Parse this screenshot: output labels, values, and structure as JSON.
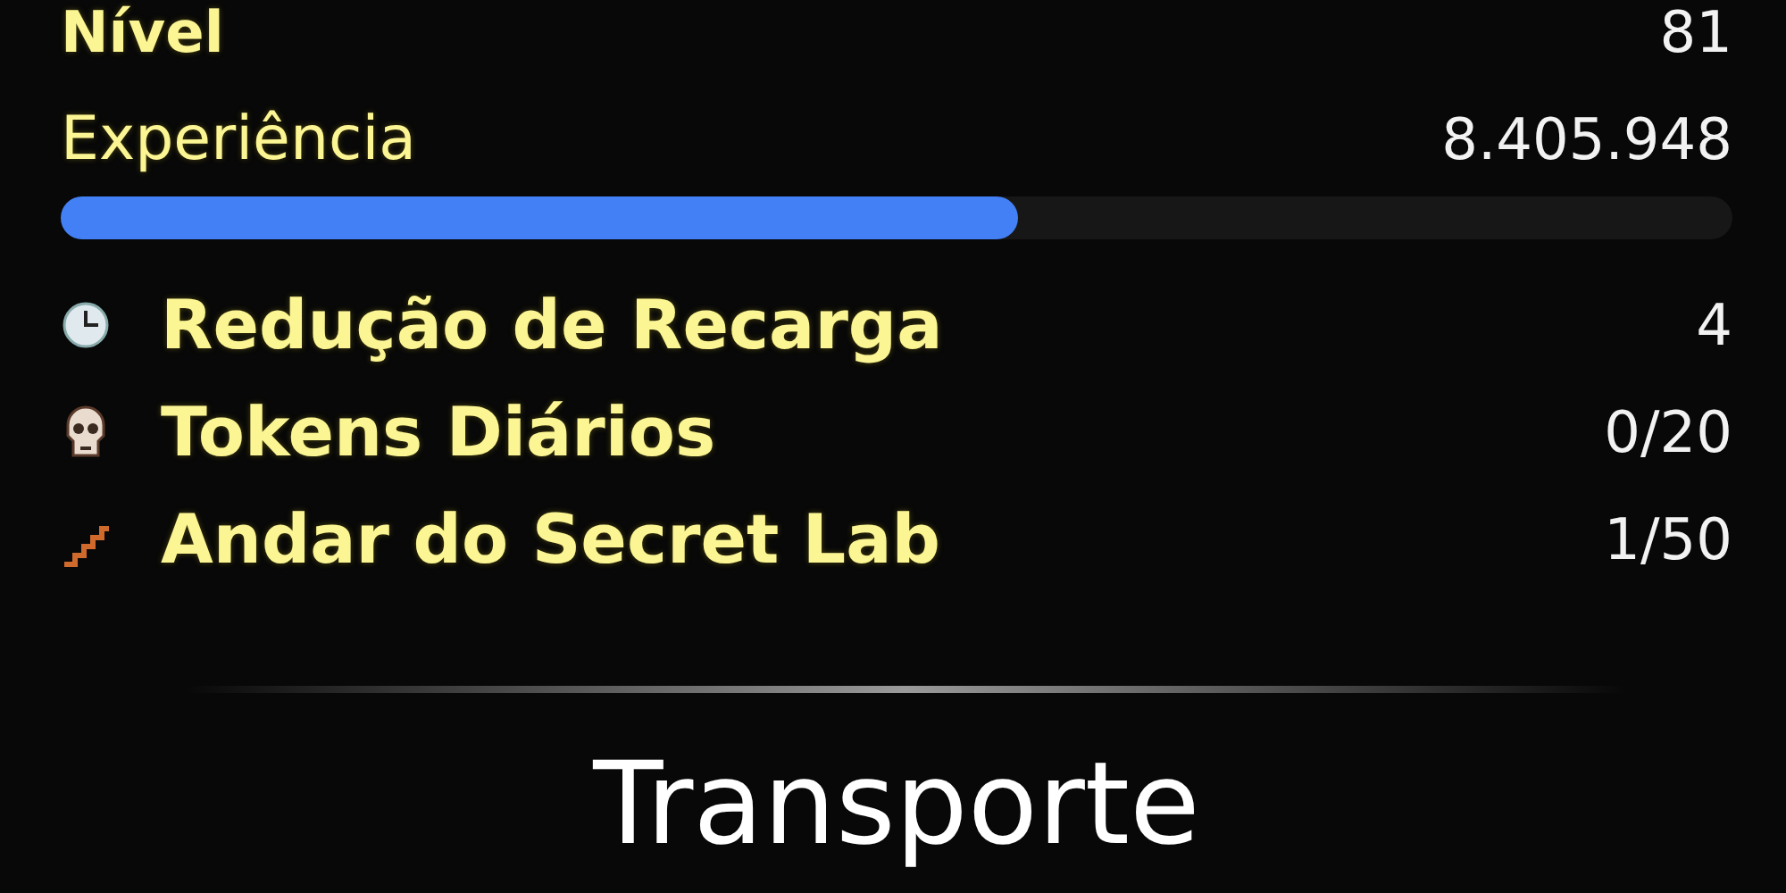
{
  "level": {
    "label": "Nível",
    "value": "81"
  },
  "experience": {
    "label": "Experiência",
    "value": "8.405.948",
    "level": 0.573
  },
  "stats": [
    {
      "kind": "clock",
      "label": "Redução de Recarga",
      "value": "4"
    },
    {
      "kind": "skull",
      "label": "Tokens Diários",
      "value": "0/20"
    },
    {
      "kind": "stairs",
      "label": "Andar do Secret Lab",
      "value": "1/50"
    }
  ],
  "section_title": "Transporte"
}
